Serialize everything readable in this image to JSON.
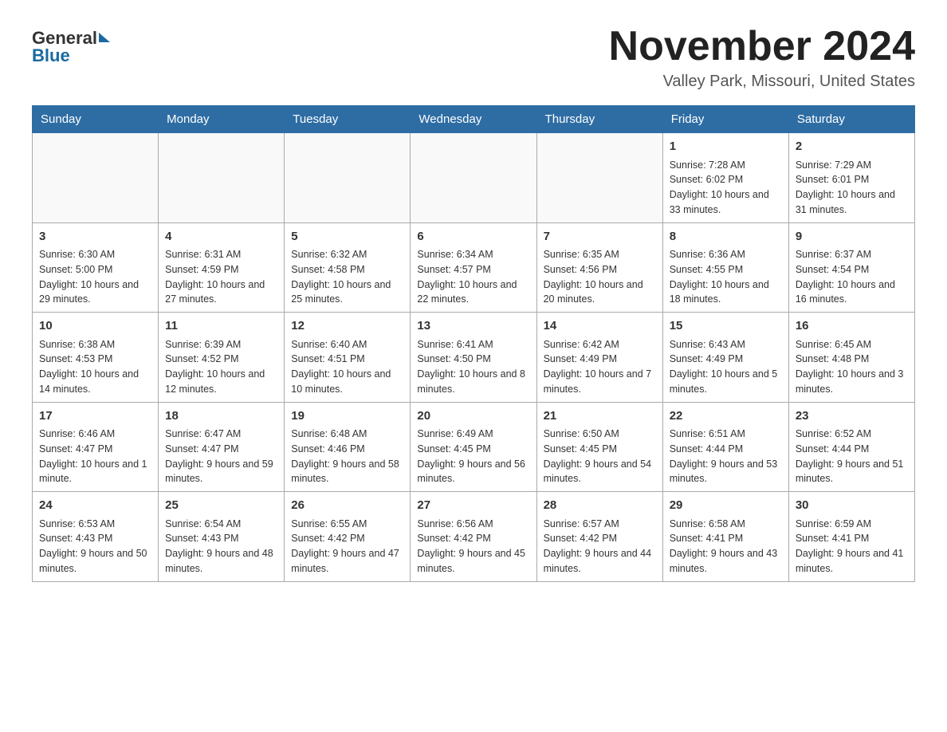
{
  "logo": {
    "general": "General",
    "blue": "Blue"
  },
  "header": {
    "title": "November 2024",
    "subtitle": "Valley Park, Missouri, United States"
  },
  "weekdays": [
    "Sunday",
    "Monday",
    "Tuesday",
    "Wednesday",
    "Thursday",
    "Friday",
    "Saturday"
  ],
  "weeks": [
    [
      {
        "day": "",
        "info": ""
      },
      {
        "day": "",
        "info": ""
      },
      {
        "day": "",
        "info": ""
      },
      {
        "day": "",
        "info": ""
      },
      {
        "day": "",
        "info": ""
      },
      {
        "day": "1",
        "info": "Sunrise: 7:28 AM\nSunset: 6:02 PM\nDaylight: 10 hours and 33 minutes."
      },
      {
        "day": "2",
        "info": "Sunrise: 7:29 AM\nSunset: 6:01 PM\nDaylight: 10 hours and 31 minutes."
      }
    ],
    [
      {
        "day": "3",
        "info": "Sunrise: 6:30 AM\nSunset: 5:00 PM\nDaylight: 10 hours and 29 minutes."
      },
      {
        "day": "4",
        "info": "Sunrise: 6:31 AM\nSunset: 4:59 PM\nDaylight: 10 hours and 27 minutes."
      },
      {
        "day": "5",
        "info": "Sunrise: 6:32 AM\nSunset: 4:58 PM\nDaylight: 10 hours and 25 minutes."
      },
      {
        "day": "6",
        "info": "Sunrise: 6:34 AM\nSunset: 4:57 PM\nDaylight: 10 hours and 22 minutes."
      },
      {
        "day": "7",
        "info": "Sunrise: 6:35 AM\nSunset: 4:56 PM\nDaylight: 10 hours and 20 minutes."
      },
      {
        "day": "8",
        "info": "Sunrise: 6:36 AM\nSunset: 4:55 PM\nDaylight: 10 hours and 18 minutes."
      },
      {
        "day": "9",
        "info": "Sunrise: 6:37 AM\nSunset: 4:54 PM\nDaylight: 10 hours and 16 minutes."
      }
    ],
    [
      {
        "day": "10",
        "info": "Sunrise: 6:38 AM\nSunset: 4:53 PM\nDaylight: 10 hours and 14 minutes."
      },
      {
        "day": "11",
        "info": "Sunrise: 6:39 AM\nSunset: 4:52 PM\nDaylight: 10 hours and 12 minutes."
      },
      {
        "day": "12",
        "info": "Sunrise: 6:40 AM\nSunset: 4:51 PM\nDaylight: 10 hours and 10 minutes."
      },
      {
        "day": "13",
        "info": "Sunrise: 6:41 AM\nSunset: 4:50 PM\nDaylight: 10 hours and 8 minutes."
      },
      {
        "day": "14",
        "info": "Sunrise: 6:42 AM\nSunset: 4:49 PM\nDaylight: 10 hours and 7 minutes."
      },
      {
        "day": "15",
        "info": "Sunrise: 6:43 AM\nSunset: 4:49 PM\nDaylight: 10 hours and 5 minutes."
      },
      {
        "day": "16",
        "info": "Sunrise: 6:45 AM\nSunset: 4:48 PM\nDaylight: 10 hours and 3 minutes."
      }
    ],
    [
      {
        "day": "17",
        "info": "Sunrise: 6:46 AM\nSunset: 4:47 PM\nDaylight: 10 hours and 1 minute."
      },
      {
        "day": "18",
        "info": "Sunrise: 6:47 AM\nSunset: 4:47 PM\nDaylight: 9 hours and 59 minutes."
      },
      {
        "day": "19",
        "info": "Sunrise: 6:48 AM\nSunset: 4:46 PM\nDaylight: 9 hours and 58 minutes."
      },
      {
        "day": "20",
        "info": "Sunrise: 6:49 AM\nSunset: 4:45 PM\nDaylight: 9 hours and 56 minutes."
      },
      {
        "day": "21",
        "info": "Sunrise: 6:50 AM\nSunset: 4:45 PM\nDaylight: 9 hours and 54 minutes."
      },
      {
        "day": "22",
        "info": "Sunrise: 6:51 AM\nSunset: 4:44 PM\nDaylight: 9 hours and 53 minutes."
      },
      {
        "day": "23",
        "info": "Sunrise: 6:52 AM\nSunset: 4:44 PM\nDaylight: 9 hours and 51 minutes."
      }
    ],
    [
      {
        "day": "24",
        "info": "Sunrise: 6:53 AM\nSunset: 4:43 PM\nDaylight: 9 hours and 50 minutes."
      },
      {
        "day": "25",
        "info": "Sunrise: 6:54 AM\nSunset: 4:43 PM\nDaylight: 9 hours and 48 minutes."
      },
      {
        "day": "26",
        "info": "Sunrise: 6:55 AM\nSunset: 4:42 PM\nDaylight: 9 hours and 47 minutes."
      },
      {
        "day": "27",
        "info": "Sunrise: 6:56 AM\nSunset: 4:42 PM\nDaylight: 9 hours and 45 minutes."
      },
      {
        "day": "28",
        "info": "Sunrise: 6:57 AM\nSunset: 4:42 PM\nDaylight: 9 hours and 44 minutes."
      },
      {
        "day": "29",
        "info": "Sunrise: 6:58 AM\nSunset: 4:41 PM\nDaylight: 9 hours and 43 minutes."
      },
      {
        "day": "30",
        "info": "Sunrise: 6:59 AM\nSunset: 4:41 PM\nDaylight: 9 hours and 41 minutes."
      }
    ]
  ]
}
